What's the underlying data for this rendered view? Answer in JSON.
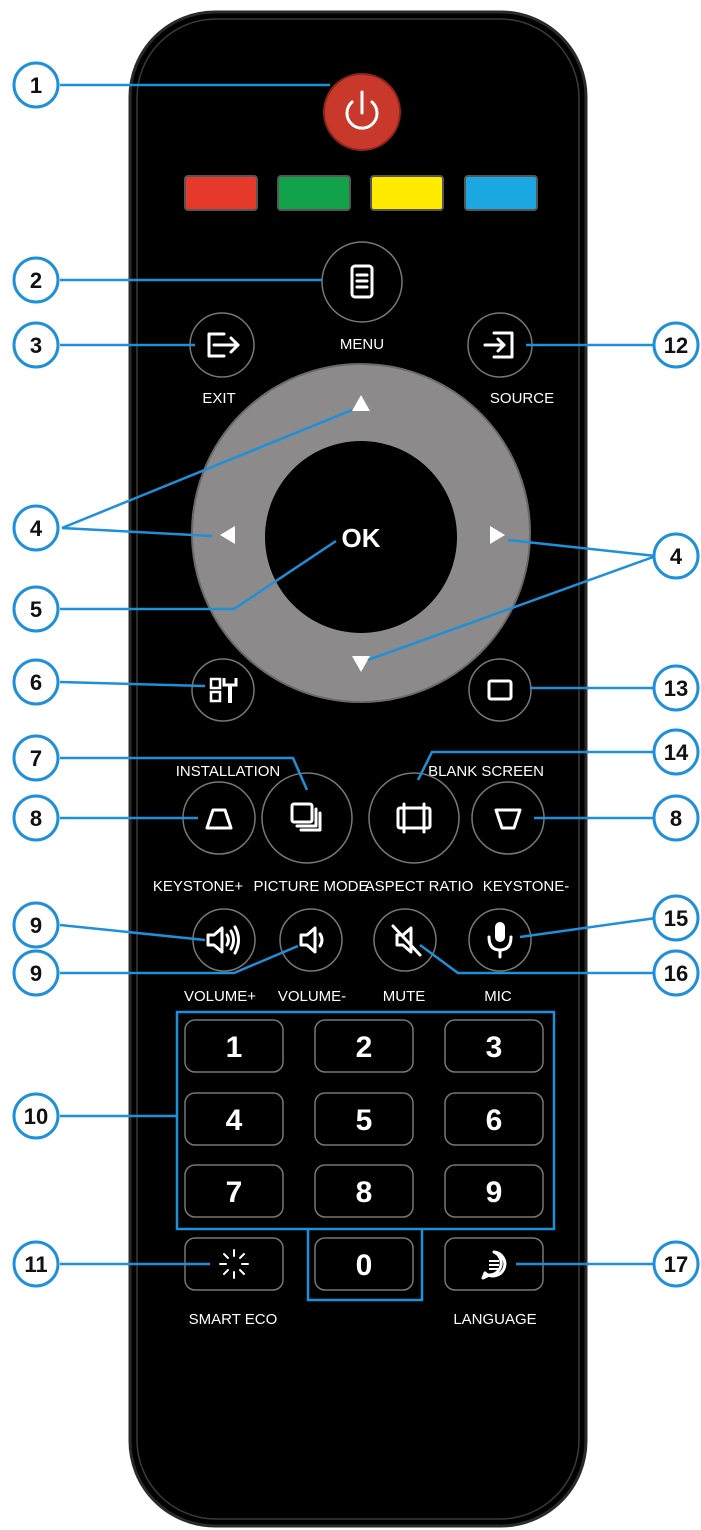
{
  "colors": {
    "power": "#c8392b",
    "red": "#e53a2b",
    "green": "#12a24a",
    "yellow": "#ffeb00",
    "blue": "#1aa7e2",
    "dpad": "#8c8a8a",
    "callout": "#1e8fd9",
    "body": "#000000"
  },
  "labels": {
    "menu": "MENU",
    "exit": "EXIT",
    "source": "SOURCE",
    "ok": "OK",
    "installation": "INSTALLATION",
    "blank_screen": "BLANK SCREEN",
    "keystone_plus": "KEYSTONE+",
    "picture_mode": "PICTURE MODE",
    "aspect_ratio": "ASPECT RATIO",
    "keystone_minus": "KEYSTONE-",
    "volume_plus": "VOLUME+",
    "volume_minus": "VOLUME-",
    "mute": "MUTE",
    "mic": "MIC",
    "smart_eco": "SMART ECO",
    "language": "LANGUAGE"
  },
  "digits": [
    "1",
    "2",
    "3",
    "4",
    "5",
    "6",
    "7",
    "8",
    "9",
    "0"
  ],
  "callouts": {
    "power": "1",
    "menu": "2",
    "exit": "3",
    "arrows_left": "4",
    "ok": "5",
    "installation": "6",
    "picture_mode": "7",
    "keystone_left": "8",
    "volume_plus": "9",
    "volume_minus": "9",
    "numpad": "10",
    "smart_eco": "11",
    "source": "12",
    "blank_screen": "13",
    "aspect_ratio": "14",
    "keystone_right": "8",
    "arrows_right": "4",
    "mic": "15",
    "mute": "16",
    "language": "17"
  },
  "icons": {
    "power": "power-icon",
    "menu": "menu-icon",
    "exit": "exit-icon",
    "source": "source-icon",
    "installation": "installation-icon",
    "blank": "blank-screen-icon",
    "picture": "picture-mode-icon",
    "aspect": "aspect-ratio-icon",
    "keystone_plus": "keystone-plus-icon",
    "keystone_minus": "keystone-minus-icon",
    "vol_plus": "volume-plus-icon",
    "vol_minus": "volume-minus-icon",
    "mute": "mute-icon",
    "mic": "mic-icon",
    "eco": "smart-eco-icon",
    "language": "language-icon"
  }
}
